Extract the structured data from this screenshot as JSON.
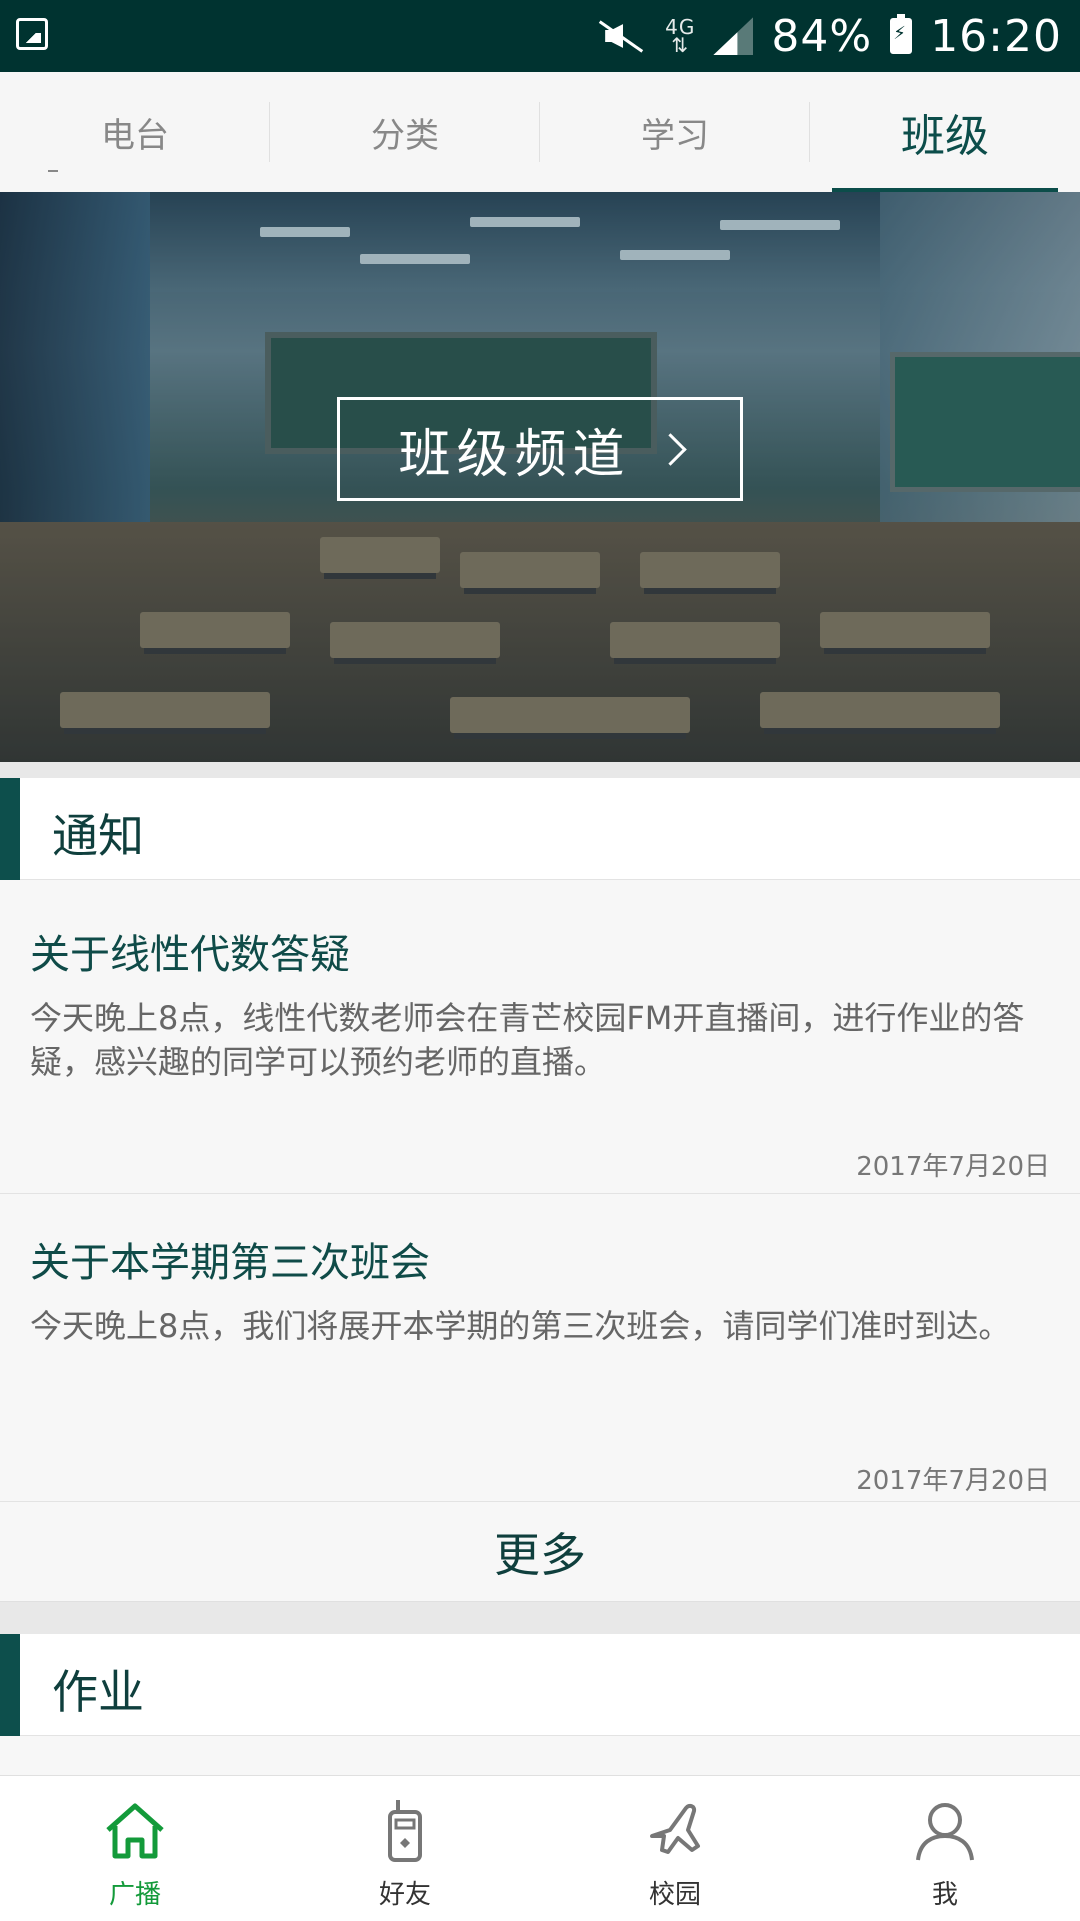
{
  "status_bar": {
    "network": "4G",
    "battery_percent": "84%",
    "time": "16:20",
    "icons": [
      "image-icon",
      "mute-icon",
      "signal-icon",
      "battery-charging-icon"
    ]
  },
  "top_tabs": [
    {
      "label": "电台",
      "active": false
    },
    {
      "label": "分类",
      "active": false
    },
    {
      "label": "学习",
      "active": false
    },
    {
      "label": "班级",
      "active": true
    }
  ],
  "hero": {
    "button_label": "班级频道"
  },
  "sections": {
    "notices": {
      "title": "通知",
      "items": [
        {
          "title": "关于线性代数答疑",
          "body": "今天晚上8点，线性代数老师会在青芒校园FM开直播间，进行作业的答疑，感兴趣的同学可以预约老师的直播。",
          "date": "2017年7月20日"
        },
        {
          "title": "关于本学期第三次班会",
          "body": "今天晚上8点，我们将展开本学期的第三次班会，请同学们准时到达。",
          "date": "2017年7月20日"
        }
      ],
      "more_label": "更多"
    },
    "homework": {
      "title": "作业"
    }
  },
  "bottom_nav": [
    {
      "label": "广播",
      "icon": "home-icon",
      "active": true
    },
    {
      "label": "好友",
      "icon": "walkie-talkie-icon",
      "active": false
    },
    {
      "label": "校园",
      "icon": "airplane-icon",
      "active": false
    },
    {
      "label": "我",
      "icon": "person-icon",
      "active": false
    }
  ],
  "colors": {
    "status_bar_bg": "#003330",
    "accent": "#0c4d4a",
    "nav_active": "#139a3a"
  }
}
